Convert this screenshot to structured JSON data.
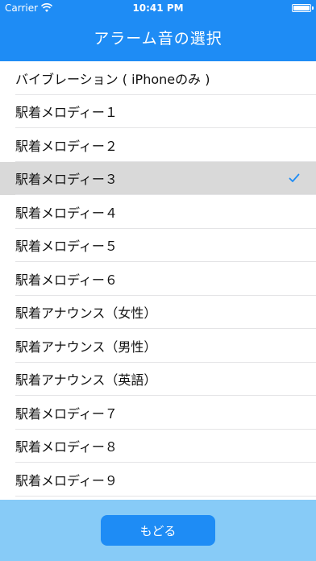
{
  "status_bar": {
    "carrier": "Carrier",
    "time": "10:41 PM",
    "battery_level": 1.0
  },
  "nav": {
    "title": "アラーム音の選択"
  },
  "list": {
    "items": [
      {
        "label": "バイブレーション ( iPhoneのみ )",
        "selected": false
      },
      {
        "label": "駅着メロディー１",
        "selected": false
      },
      {
        "label": "駅着メロディー２",
        "selected": false
      },
      {
        "label": "駅着メロディー３",
        "selected": true
      },
      {
        "label": "駅着メロディー４",
        "selected": false
      },
      {
        "label": "駅着メロディー５",
        "selected": false
      },
      {
        "label": "駅着メロディー６",
        "selected": false
      },
      {
        "label": "駅着アナウンス（女性）",
        "selected": false
      },
      {
        "label": "駅着アナウンス（男性）",
        "selected": false
      },
      {
        "label": "駅着アナウンス（英語）",
        "selected": false
      },
      {
        "label": "駅着メロディー７",
        "selected": false
      },
      {
        "label": "駅着メロディー８",
        "selected": false
      },
      {
        "label": "駅着メロディー９",
        "selected": false
      }
    ]
  },
  "footer": {
    "back_label": "もどる"
  },
  "colors": {
    "header_bg": "#1e8cf5",
    "footer_bg": "#87cbf7",
    "selected_row_bg": "#d9d9d9",
    "checkmark": "#1e8cf5"
  },
  "icons": {
    "wifi": "wifi-icon",
    "battery": "battery-icon",
    "selected_mark": "check-icon"
  }
}
